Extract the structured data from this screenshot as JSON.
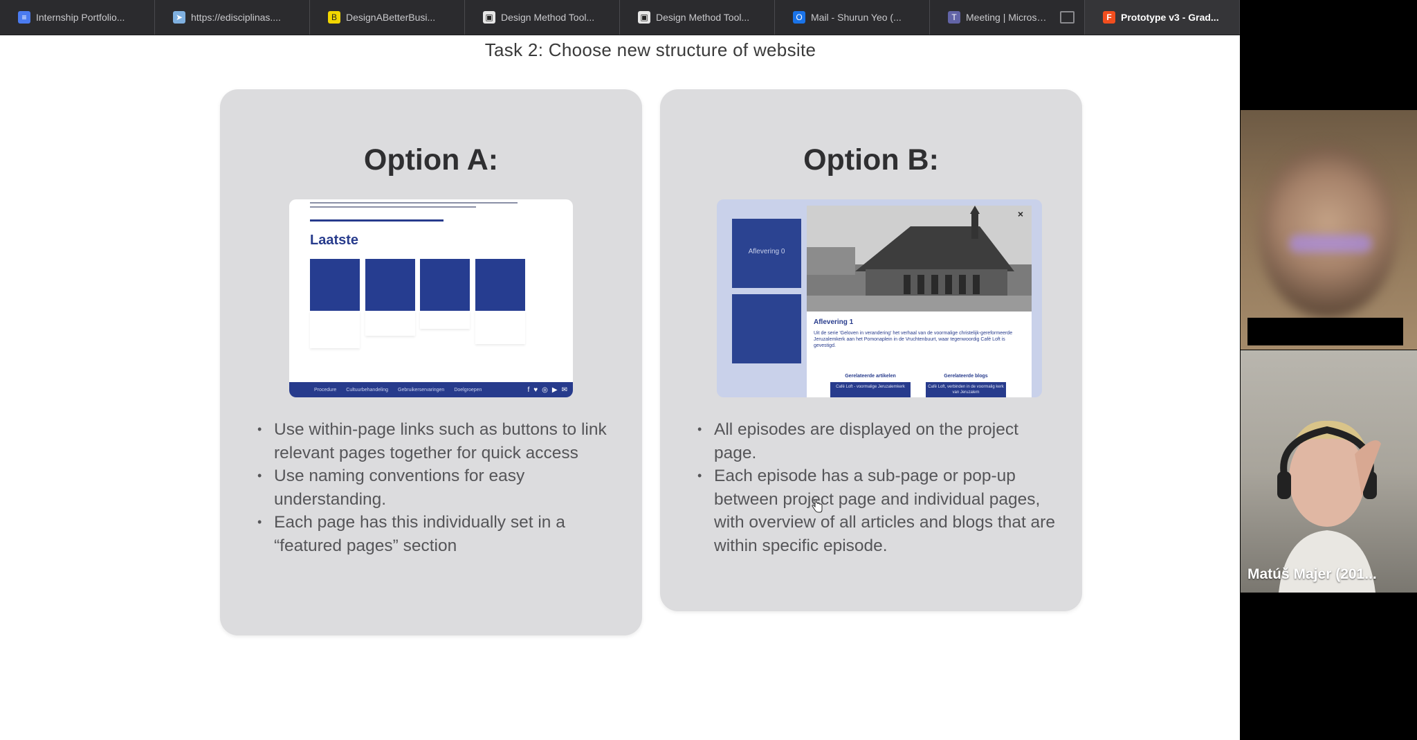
{
  "tabs": [
    {
      "label": "Internship Portfolio...",
      "icon": "docs-icon",
      "color": "#4a7bf0",
      "glyph": "≡",
      "active": false
    },
    {
      "label": "https://edisciplinas....",
      "icon": "link-icon",
      "color": "#7fb0e0",
      "glyph": "➤",
      "active": false
    },
    {
      "label": "DesignABetterBusi...",
      "icon": "miro-icon",
      "color": "#f2d600",
      "glyph": "B",
      "active": false
    },
    {
      "label": "Design Method Tool...",
      "icon": "page-icon",
      "color": "#e6e6e6",
      "glyph": "▣",
      "active": false
    },
    {
      "label": "Design Method Tool...",
      "icon": "page-icon",
      "color": "#e6e6e6",
      "glyph": "▣",
      "active": false
    },
    {
      "label": "Mail - Shurun Yeo (...",
      "icon": "outlook-icon",
      "color": "#1a73e8",
      "glyph": "O",
      "active": false
    },
    {
      "label": "Meeting | Microsoft...",
      "icon": "teams-icon",
      "color": "#6264a7",
      "glyph": "T",
      "active": false
    },
    {
      "label": "Prototype v3 - Grad...",
      "icon": "figma-icon",
      "color": "#f24e1e",
      "glyph": "F",
      "active": true
    }
  ],
  "slide": {
    "title": "Task 2: Choose new structure of website",
    "option_a": {
      "heading": "Option A:",
      "thumb_heading": "Laatste",
      "footer_links": [
        "Procedure",
        "Cultuurbehandeling",
        "Gebruikerservaringen",
        "Doelgroepen"
      ],
      "bullets": [
        "Use within-page links such as buttons to link relevant pages together for quick access",
        "Use naming conventions for easy understanding.",
        "Each page has this individually set in  a “featured pages” section"
      ]
    },
    "option_b": {
      "heading": "Option B:",
      "thumb_tile_label": "Aflevering 0",
      "thumb_popup_title": "Aflevering 1",
      "thumb_popup_desc": "Uit de serie 'Geloven in verandering' het verhaal van de voormalige christelijk-gereformeerde Jeruzalemkerk aan het Pomonaplein in de Vruchtenbuurt, waar tegenwoordig Café Loft is gevestigd.",
      "thumb_rel_articles": "Gerelateerde artikelen",
      "thumb_rel_blogs": "Gerelateerde blogs",
      "thumb_btn_1": "Café Loft - voormalige Jeruzalemkerk",
      "thumb_btn_2": "Café Loft, verbinden in de voormalig kerk van Jeruzalem",
      "bullets": [
        "All episodes are displayed on the project page.",
        "Each episode has a sub-page or pop-up between project page and individual pages, with overview of all articles and blogs that are within specific episode."
      ]
    }
  },
  "participants": {
    "second_name": "Matúš Majer (201..."
  }
}
